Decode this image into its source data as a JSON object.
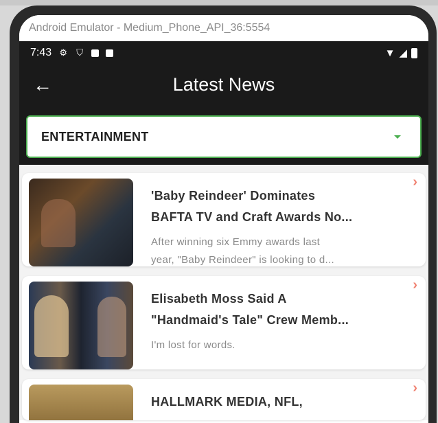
{
  "window": {
    "title": "Android Emulator - Medium_Phone_API_36:5554"
  },
  "status_bar": {
    "time": "7:43"
  },
  "app_bar": {
    "back_icon": "arrow-left-icon",
    "title": "Latest News"
  },
  "category_dropdown": {
    "selected": "ENTERTAINMENT"
  },
  "articles": [
    {
      "title_line1": "'Baby Reindeer' Dominates",
      "title_line2": "BAFTA TV and Craft Awards No...",
      "desc_line1": "After winning six Emmy awards last",
      "desc_line2": "year, \"Baby Reindeer\" is looking to d..."
    },
    {
      "title_line1": "Elisabeth Moss Said A",
      "title_line2": "\"Handmaid's Tale\" Crew Memb...",
      "desc_line1": "I'm lost for words.",
      "desc_line2": ""
    },
    {
      "title_line1": "HALLMARK MEDIA, NFL,",
      "title_line2": "",
      "desc_line1": "",
      "desc_line2": ""
    }
  ],
  "colors": {
    "app_bar_bg": "#1a1a1a",
    "dropdown_border": "#4caf50",
    "chevron": "#f08070",
    "title_text": "#333333",
    "desc_text": "#8a8a8a"
  }
}
